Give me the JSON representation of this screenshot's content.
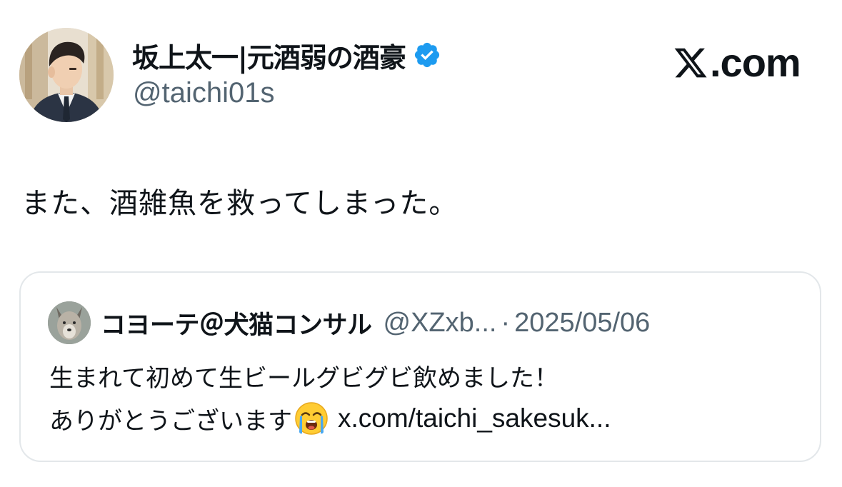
{
  "author": {
    "display_name": "坂上太一|元酒弱の酒豪",
    "handle": "@taichi01s",
    "verified_icon": "verified-badge-icon",
    "avatar_icon": "avatar-illustration-man-in-suit"
  },
  "brand": {
    "logo_icon": "x-logo-icon",
    "text": ".com"
  },
  "tweet": {
    "text": "また、酒雑魚を救ってしまった。"
  },
  "quoted_tweet": {
    "display_name": "コヨーテ＠犬猫コンサル",
    "handle": "@XZxb...",
    "separator": "·",
    "date": "2025/05/06",
    "line1": "生まれて初めて生ビールグビグビ飲めました！",
    "line2_text": "ありがとうございます",
    "emoji_icon": "loudly-crying-face-icon",
    "link": "x.com/taichi_sakesuk..."
  },
  "colors": {
    "text_primary": "#0f1419",
    "text_secondary": "#536471",
    "verified_blue": "#1d9bf0",
    "card_border": "#e3e7ea"
  }
}
